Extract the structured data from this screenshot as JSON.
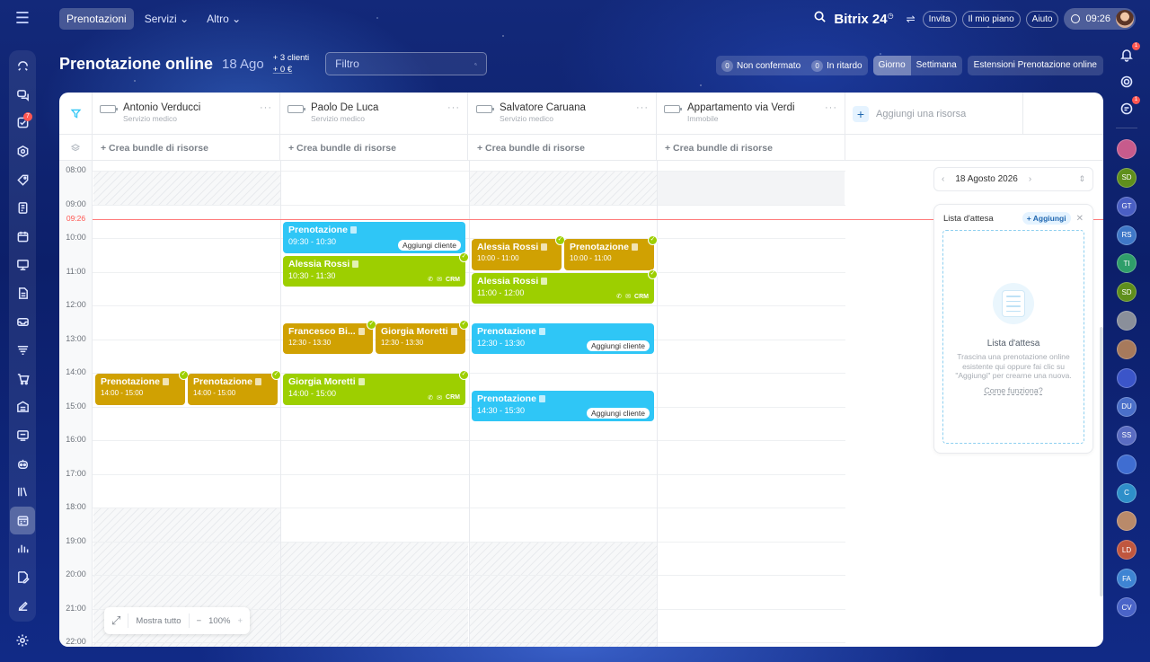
{
  "topbar": {
    "nav": [
      {
        "label": "Prenotazioni"
      },
      {
        "label": "Servizi"
      },
      {
        "label": "Altro"
      }
    ],
    "brand": "Bitrix 24",
    "invite": "Invita",
    "plan": "Il mio piano",
    "help": "Aiuto",
    "time": "09:26"
  },
  "header": {
    "title": "Prenotazione online",
    "date": "18 Ago",
    "clients": "+ 3 clienti",
    "money": "+ 0 €",
    "search_placeholder": "Filtro",
    "unconfirmed_count": "0",
    "unconfirmed_label": "Non confermato",
    "late_count": "0",
    "late_label": "In ritardo",
    "view_day": "Giorno",
    "view_week": "Settimana",
    "extensions": "Estensioni Prenotazione online"
  },
  "resources": [
    {
      "name": "Antonio Verducci",
      "type": "Servizio medico",
      "load": 0.7
    },
    {
      "name": "Paolo De Luca",
      "type": "Servizio medico",
      "load": 0.7
    },
    {
      "name": "Salvatore Caruana",
      "type": "Servizio medico",
      "load": 0.7
    },
    {
      "name": "Appartamento via Verdi",
      "type": "Immobile",
      "load": 0
    }
  ],
  "add_resource": "Aggiungi una risorsa",
  "bundle_label": "+ Crea bundle di risorse",
  "hours": [
    "08:00",
    "09:00",
    "10:00",
    "11:00",
    "12:00",
    "13:00",
    "14:00",
    "15:00",
    "16:00",
    "17:00",
    "18:00",
    "19:00",
    "20:00",
    "21:00",
    "22:00"
  ],
  "now": "09:26",
  "bookings": [
    {
      "col": 1,
      "start": "09:30",
      "end": "10:30",
      "title": "Prenotazione",
      "time": "09:30 - 10:30",
      "color": "blue",
      "action": "Aggiungi cliente"
    },
    {
      "col": 1,
      "start": "10:30",
      "end": "11:30",
      "title": "Alessia Rossi",
      "time": "10:30 - 11:30",
      "color": "green",
      "confirmed": true,
      "crm": true
    },
    {
      "col": 2,
      "start": "10:00",
      "end": "11:00",
      "title": "Alessia Rossi",
      "time": "10:00 - 11:00",
      "color": "gold",
      "confirmed": true,
      "half": 0
    },
    {
      "col": 2,
      "start": "10:00",
      "end": "11:00",
      "title": "Prenotazione",
      "time": "10:00 - 11:00",
      "color": "gold",
      "confirmed": true,
      "half": 1
    },
    {
      "col": 2,
      "start": "11:00",
      "end": "12:00",
      "title": "Alessia Rossi",
      "time": "11:00 - 12:00",
      "color": "green",
      "confirmed": true,
      "crm": true
    },
    {
      "col": 1,
      "start": "12:30",
      "end": "13:30",
      "title": "Francesco Bi...",
      "time": "12:30 - 13:30",
      "color": "gold",
      "confirmed": true,
      "half": 0
    },
    {
      "col": 1,
      "start": "12:30",
      "end": "13:30",
      "title": "Giorgia Moretti",
      "time": "12:30 - 13:30",
      "color": "gold",
      "confirmed": true,
      "half": 1
    },
    {
      "col": 2,
      "start": "12:30",
      "end": "13:30",
      "title": "Prenotazione",
      "time": "12:30 - 13:30",
      "color": "blue",
      "action": "Aggiungi cliente"
    },
    {
      "col": 0,
      "start": "14:00",
      "end": "15:00",
      "title": "Prenotazione",
      "time": "14:00 - 15:00",
      "color": "gold",
      "confirmed": true,
      "half": 0
    },
    {
      "col": 0,
      "start": "14:00",
      "end": "15:00",
      "title": "Prenotazione",
      "time": "14:00 - 15:00",
      "color": "gold",
      "confirmed": true,
      "half": 1
    },
    {
      "col": 1,
      "start": "14:00",
      "end": "15:00",
      "title": "Giorgia Moretti",
      "time": "14:00 - 15:00",
      "color": "green",
      "confirmed": true,
      "crm": true
    },
    {
      "col": 2,
      "start": "14:30",
      "end": "15:30",
      "title": "Prenotazione",
      "time": "14:30 - 15:30",
      "color": "blue",
      "action": "Aggiungi cliente"
    }
  ],
  "crm_label": "CRM",
  "zoom": {
    "show_all": "Mostra tutto",
    "level": "100%"
  },
  "date_picker": "18 Agosto 2026",
  "waitlist": {
    "title": "Lista d'attesa",
    "add": "+ Aggiungi",
    "empty_title": "Lista d'attesa",
    "empty_desc": "Trascina una prenotazione online esistente qui oppure fai clic su \"Aggiungi\" per crearne una nuova.",
    "how": "Come funziona?"
  },
  "sidebar_badges": {
    "tasks": "7"
  },
  "right_rail": {
    "notifications_badge": "1",
    "chat_badge": "1",
    "chats": [
      {
        "label": "",
        "color": "#c75b8c"
      },
      {
        "label": "SD",
        "color": "#5f8f1c"
      },
      {
        "label": "GT",
        "color": "#4a5fc4"
      },
      {
        "label": "RS",
        "color": "#3f78c8"
      },
      {
        "label": "TI",
        "color": "#2f9e6a"
      },
      {
        "label": "SD",
        "color": "#5f8f1c"
      },
      {
        "label": "",
        "color": "#8a8f9a"
      },
      {
        "label": "",
        "color": "#a77a5c"
      },
      {
        "label": "",
        "color": "#3b55c9"
      },
      {
        "label": "DU",
        "color": "#4a6fc9"
      },
      {
        "label": "SS",
        "color": "#5a6cc2"
      },
      {
        "label": "",
        "color": "#3f6dd1"
      },
      {
        "label": "C",
        "color": "#2e8fc9"
      },
      {
        "label": "",
        "color": "#b98a6a"
      },
      {
        "label": "LD",
        "color": "#c0573f"
      },
      {
        "label": "FA",
        "color": "#3e84d3"
      },
      {
        "label": "CV",
        "color": "#4a64c8"
      }
    ]
  }
}
